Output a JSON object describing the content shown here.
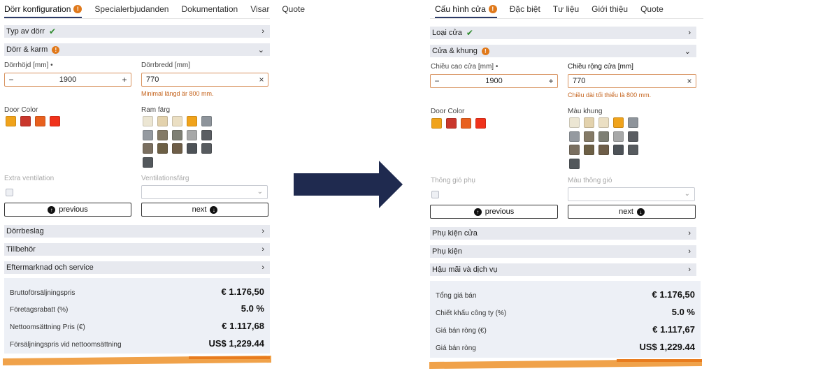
{
  "left": {
    "tabs": [
      {
        "label": "Dörr konfiguration",
        "active": true,
        "badge": "!"
      },
      {
        "label": "Specialerbjudanden"
      },
      {
        "label": "Dokumentation"
      },
      {
        "label": "Visar"
      },
      {
        "label": "Quote"
      }
    ],
    "door_type": {
      "label": "Typ av dörr"
    },
    "door_frame": {
      "label": "Dörr & karm"
    },
    "height": {
      "label": "Dörrhöjd [mm]",
      "required_mark": "•",
      "value": "1900"
    },
    "width": {
      "label": "Dörrbredd [mm]",
      "value": "770",
      "hint": "Minimal längd är 800 mm."
    },
    "door_color": {
      "label": "Door Color"
    },
    "frame_color": {
      "label": "Ram färg"
    },
    "ventilation": {
      "label": "Extra ventilation"
    },
    "vent_color": {
      "label": "Ventilationsfärg"
    },
    "prev_label": "previous",
    "next_label": "next",
    "sections": [
      "Dörrbeslag",
      "Tillbehör",
      "Eftermarknad och service"
    ],
    "summary": [
      {
        "label": "Bruttoförsäljningspris",
        "value": "€ 1.176,50"
      },
      {
        "label": "Företagsrabatt (%)",
        "value": "5.0 %"
      },
      {
        "label": "Nettoomsättning Pris (€)",
        "value": "€ 1.117,68"
      },
      {
        "label": "Försäljningspris vid nettoomsättning",
        "value": "US$ 1,229.44"
      }
    ]
  },
  "right": {
    "tabs": [
      {
        "label": "Cấu hình cửa",
        "active": true,
        "badge": "!"
      },
      {
        "label": "Đặc biệt"
      },
      {
        "label": "Tư liệu"
      },
      {
        "label": "Giới thiệu"
      },
      {
        "label": "Quote"
      }
    ],
    "door_type": {
      "label": "Loại cửa"
    },
    "door_frame": {
      "label": "Cửa & khung"
    },
    "height": {
      "label": "Chiều cao cửa [mm]",
      "required_mark": "•",
      "value": "1900"
    },
    "width": {
      "label": "Chiều rộng cửa [mm]",
      "value": "770",
      "hint": "Chiều dài tối thiểu là 800 mm."
    },
    "door_color": {
      "label": "Door Color"
    },
    "frame_color": {
      "label": "Màu khung"
    },
    "ventilation": {
      "label": "Thông gió phụ"
    },
    "vent_color": {
      "label": "Màu thông gió"
    },
    "prev_label": "previous",
    "next_label": "next",
    "sections": [
      "Phụ kiện cửa",
      "Phụ kiện",
      "Hậu mãi và dịch vụ"
    ],
    "summary": [
      {
        "label": "Tổng giá bán",
        "value": "€ 1.176,50"
      },
      {
        "label": "Chiết khấu công ty (%)",
        "value": "5.0 %"
      },
      {
        "label": "Giá bán ròng (€)",
        "value": "€ 1.117,67"
      },
      {
        "label": "Giá bán ròng",
        "value": "US$ 1,229.44"
      }
    ]
  },
  "colors": {
    "accent": "#e0791b",
    "nav_arrow": "#1f2a4f",
    "door_swatches": [
      "#f0a31b",
      "#c9372c",
      "#e8601e",
      "#f0321b"
    ],
    "frame_swatches": [
      "#ece6d3",
      "#e3d2ad",
      "#ebdfc3",
      "#f0a31b",
      "#8e949b",
      "#959aa0",
      "#847a66",
      "#7e7f74",
      "#a7a8a8",
      "#5a5d62",
      "#7a6f60",
      "#6c5f45",
      "#6e5e48",
      "#4d5257",
      "#575b5f",
      "#53585c"
    ]
  },
  "icons": {
    "check": "check-icon",
    "chevron_right": "chevron-right-icon",
    "chevron_down": "chevron-down-icon",
    "arrow_up": "arrow-up-circle-icon",
    "arrow_down": "arrow-down-circle-icon",
    "clear": "clear-icon"
  }
}
